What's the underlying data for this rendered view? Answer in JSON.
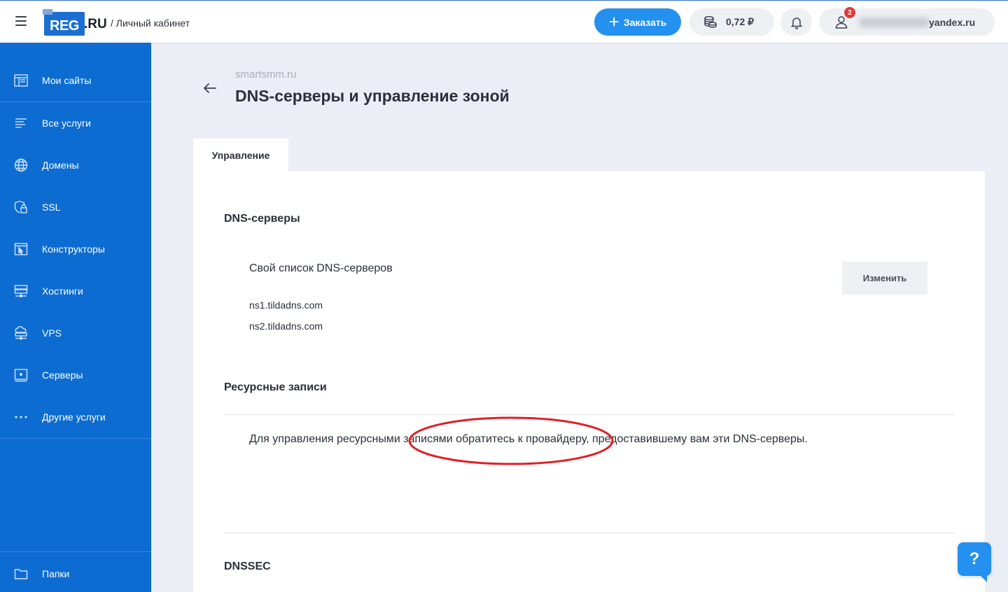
{
  "header": {
    "logo_text_reg": "REG",
    "logo_text_ru": ".RU",
    "cabinet_label": "/ Личный кабинет",
    "order_label": "Заказать",
    "balance": "0,72 ₽",
    "notifications_count": "2",
    "user_email_visible": "yandex.ru",
    "accent_color": "#2490f0"
  },
  "sidebar": {
    "background": "#0d6cd1",
    "items": [
      {
        "label": "Мои сайты",
        "icon": "sites-icon"
      },
      {
        "label": "Все услуги",
        "icon": "list-icon"
      },
      {
        "label": "Домены",
        "icon": "globe-icon"
      },
      {
        "label": "SSL",
        "icon": "shield-lock-icon"
      },
      {
        "label": "Конструкторы",
        "icon": "constructor-icon"
      },
      {
        "label": "Хостинги",
        "icon": "hosting-icon"
      },
      {
        "label": "VPS",
        "icon": "vps-icon"
      },
      {
        "label": "Серверы",
        "icon": "server-icon"
      },
      {
        "label": "Другие услуги",
        "icon": "dots-icon"
      }
    ],
    "footer_item": {
      "label": "Папки",
      "icon": "folder-icon"
    }
  },
  "page": {
    "domain": "smartsmm.ru",
    "title": "DNS-серверы и управление зоной",
    "tab": "Управление"
  },
  "dns": {
    "section_title": "DNS-серверы",
    "list_label": "Свой список DNS-серверов",
    "change_button": "Изменить",
    "servers": [
      "ns1.tildadns.com",
      "ns2.tildadns.com"
    ]
  },
  "records": {
    "section_title": "Ресурсные записи",
    "info": "Для управления ресурсными записями обратитесь к провайдеру, предоставившему вам эти DNS-серверы."
  },
  "dnssec": {
    "section_title": "DNSSEC"
  },
  "help_label": "?"
}
